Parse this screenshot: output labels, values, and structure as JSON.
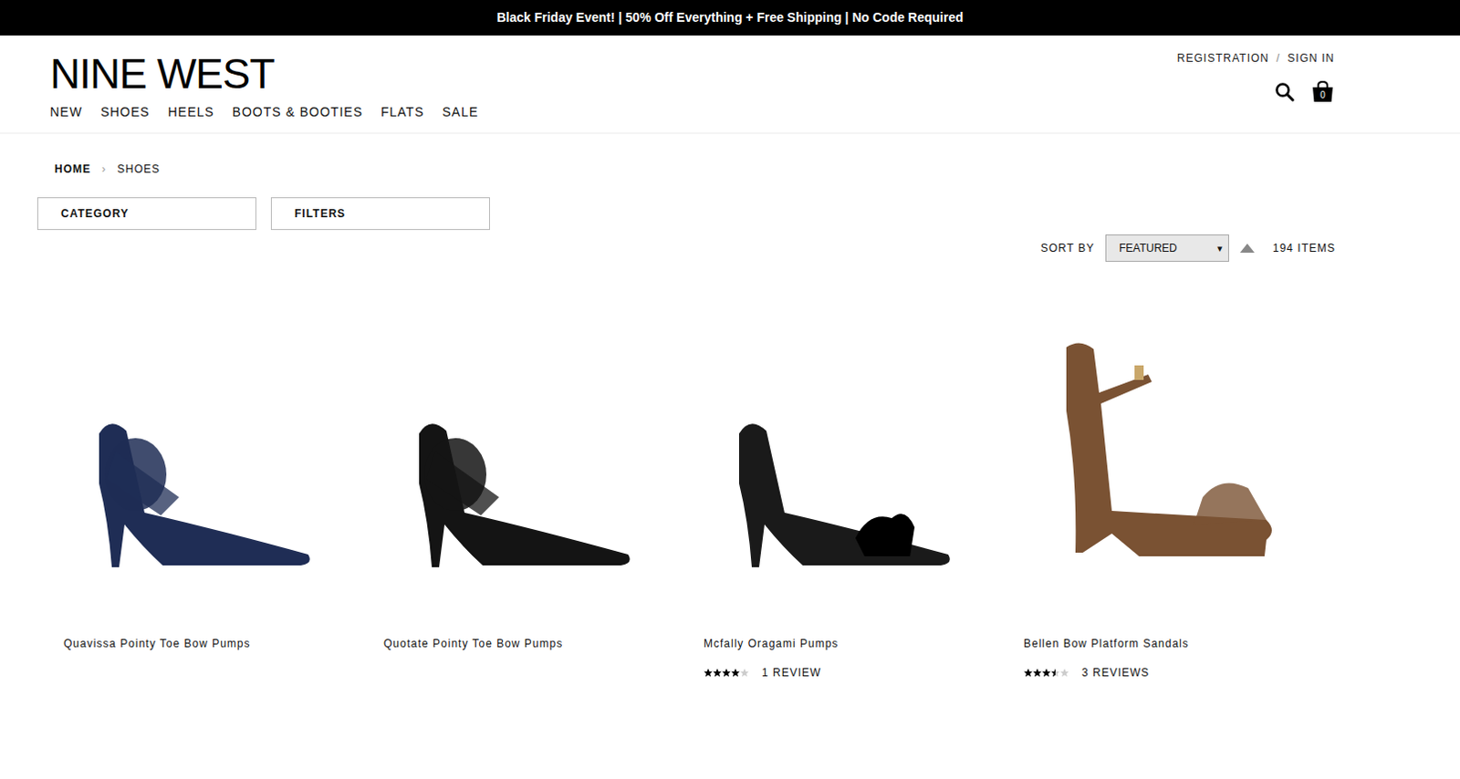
{
  "banner": {
    "text": "Black Friday Event! | 50% Off Everything + Free Shipping | No Code Required"
  },
  "header": {
    "logo": "NINE WEST",
    "nav": [
      "NEW",
      "SHOES",
      "HEELS",
      "BOOTS & BOOTIES",
      "FLATS",
      "SALE"
    ],
    "account": {
      "register": "REGISTRATION",
      "separator": "/",
      "sign_in": "SIGN IN"
    },
    "cart_count": "0"
  },
  "breadcrumb": {
    "items": [
      "HOME",
      "SHOES"
    ],
    "separator": "›"
  },
  "filters": [
    "CATEGORY",
    "FILTERS"
  ],
  "sort": {
    "label": "SORT BY",
    "value": "FEATURED",
    "arrow": "▾",
    "count": "194 ITEMS"
  },
  "products": [
    {
      "name": "Quavissa Pointy Toe Bow Pumps",
      "color": "#1f2d55",
      "kind": "pump"
    },
    {
      "name": "Quotate Pointy Toe Bow Pumps",
      "color": "#141414",
      "kind": "pump"
    },
    {
      "name": "Mcfally Oragami Pumps",
      "color": "#1a1a1a",
      "kind": "dorsay",
      "stars": 4,
      "reviews": "1 REVIEW"
    },
    {
      "name": "Bellen Bow Platform Sandals",
      "color": "#7a5233",
      "kind": "sandal",
      "stars": 3.5,
      "reviews": "3 REVIEWS"
    }
  ]
}
